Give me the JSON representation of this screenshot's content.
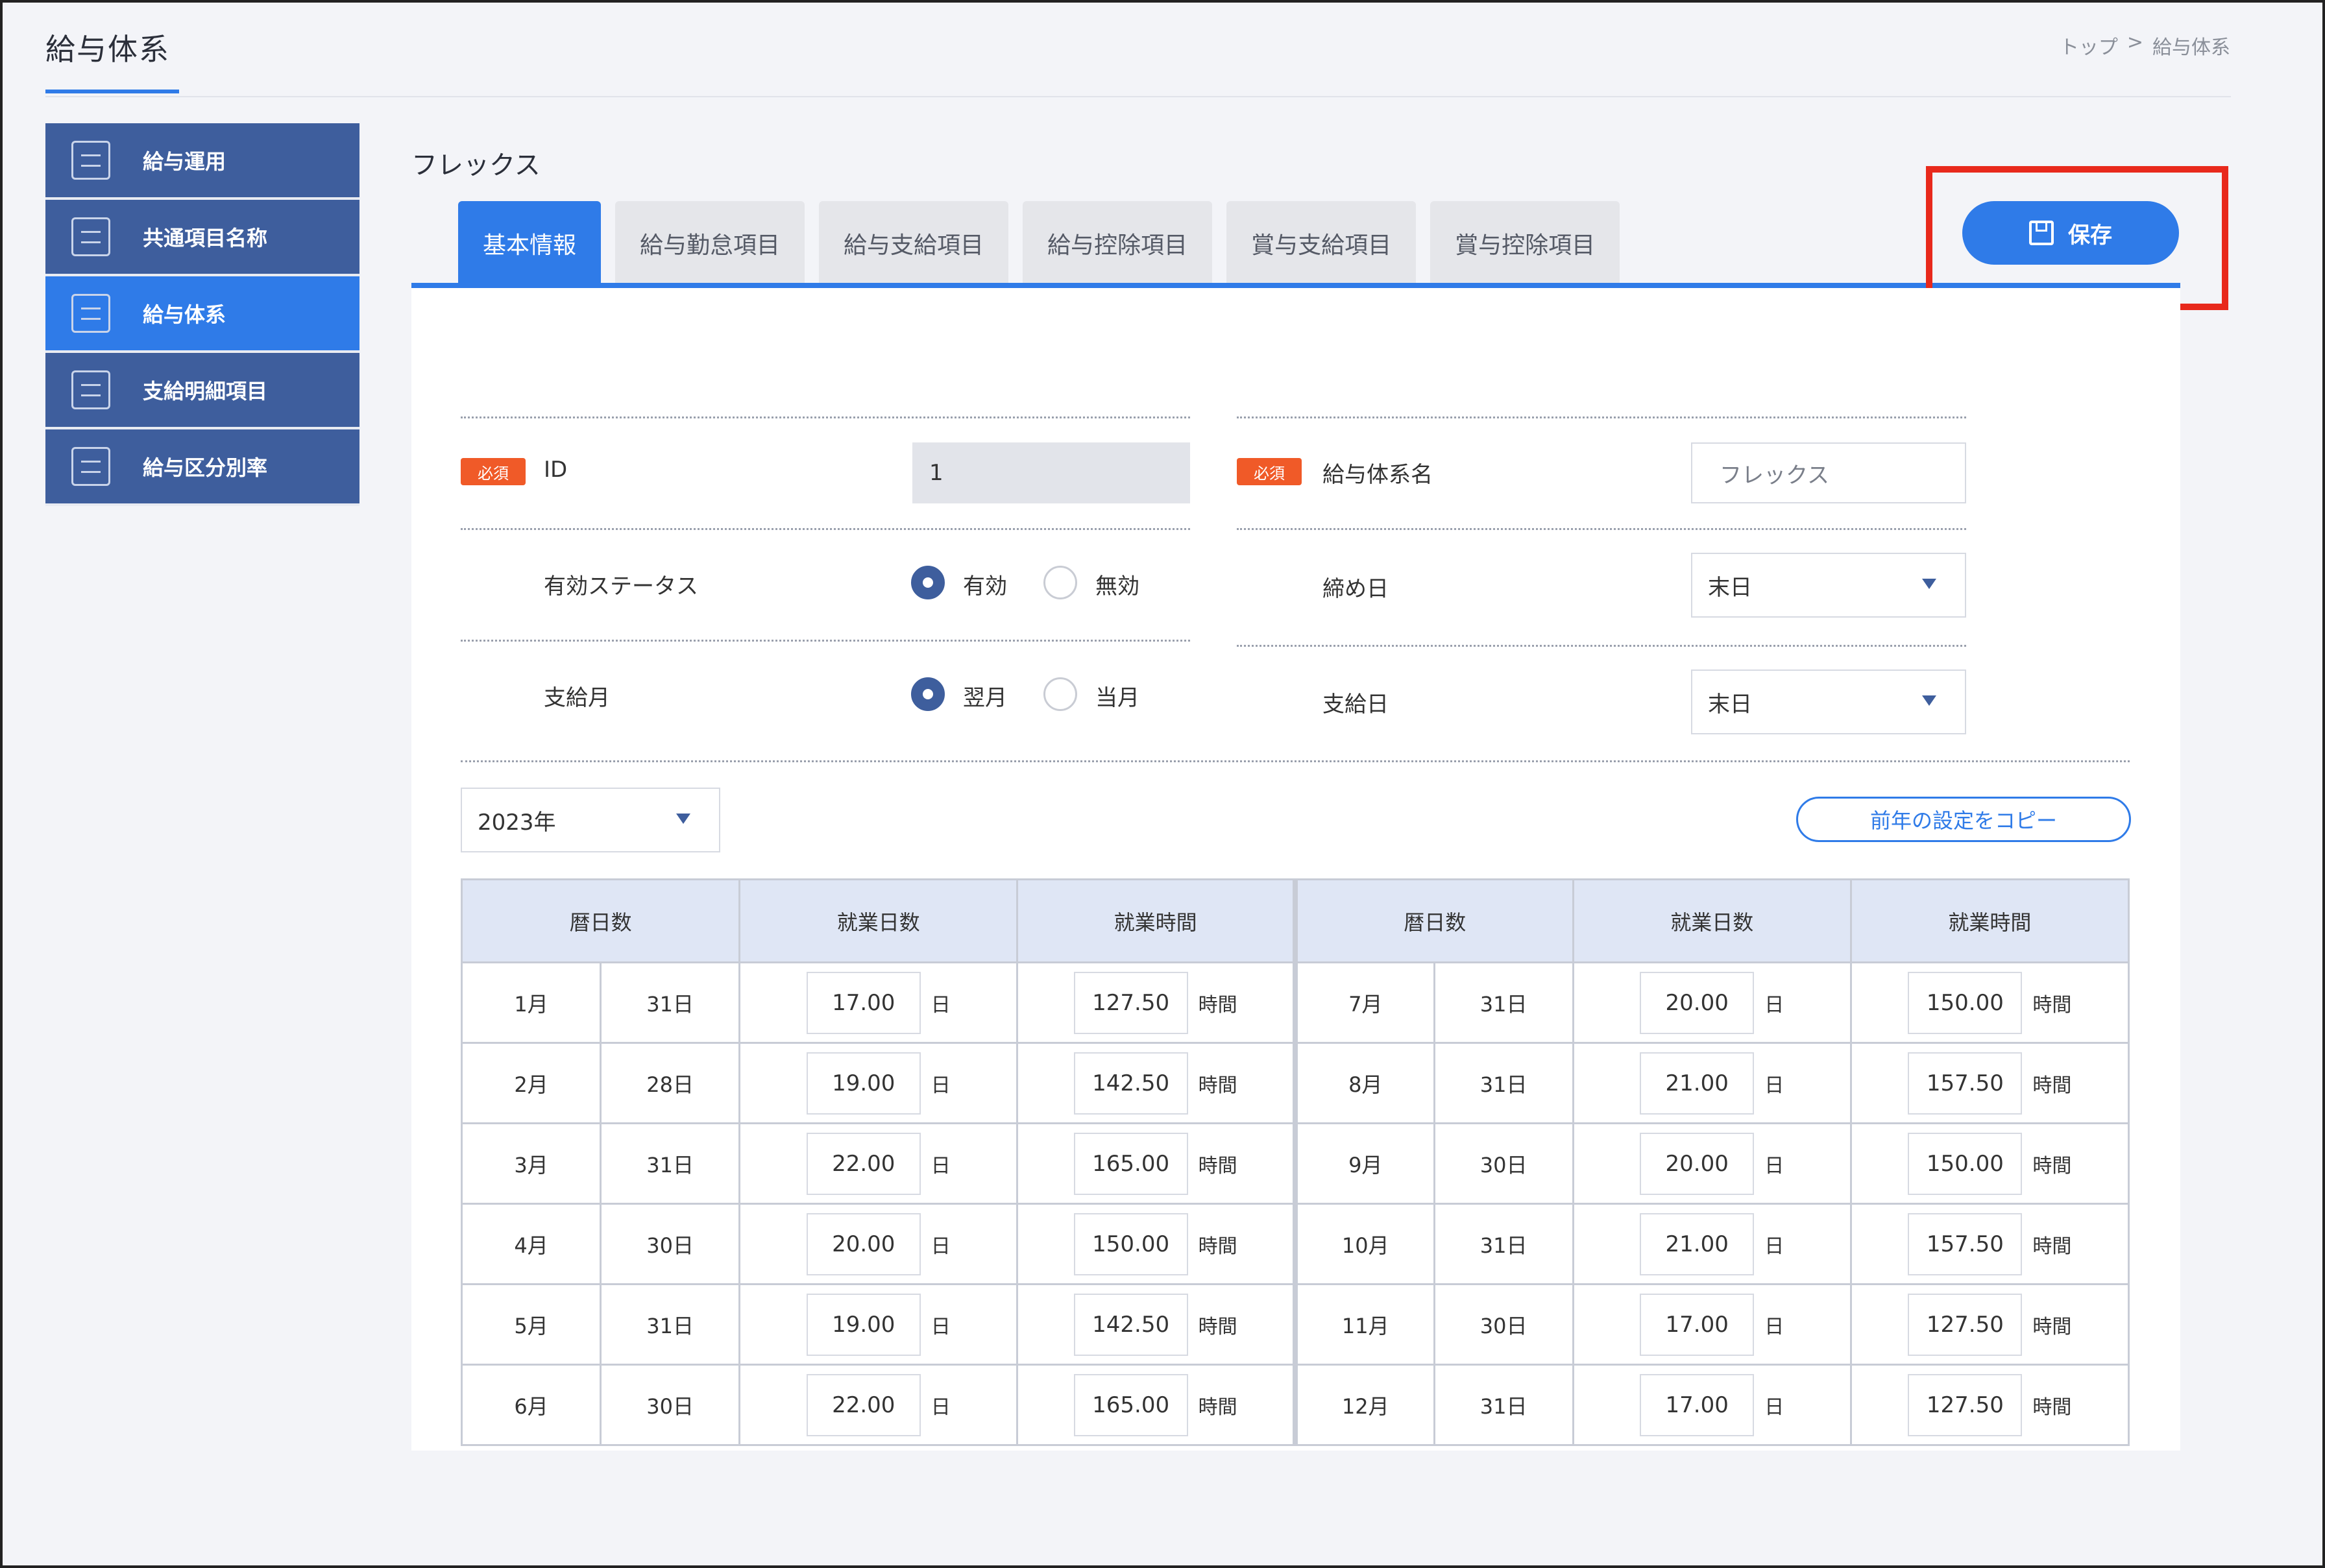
{
  "header": {
    "title": "給与体系",
    "breadcrumb": [
      "トップ",
      ">",
      "給与体系"
    ]
  },
  "sidebar": {
    "items": [
      {
        "label": "給与運用",
        "icon": "ledger-icon"
      },
      {
        "label": "共通項目名称",
        "icon": "document-dollar-icon"
      },
      {
        "label": "給与体系",
        "icon": "chart-doc-icon",
        "active": true
      },
      {
        "label": "支給明細項目",
        "icon": "receipt-icon"
      },
      {
        "label": "給与区分別率",
        "icon": "calculator-icon"
      }
    ]
  },
  "main": {
    "section_title": "フレックス",
    "tabs": [
      "基本情報",
      "給与勤怠項目",
      "給与支給項目",
      "給与控除項目",
      "賞与支給項目",
      "賞与控除項目"
    ],
    "save_label": "保存"
  },
  "form": {
    "required_badge": "必須",
    "id_label": "ID",
    "id_value": "1",
    "name_label": "給与体系名",
    "name_value": "フレックス",
    "status_label": "有効ステータス",
    "status_on": "有効",
    "status_off": "無効",
    "closing_label": "締め日",
    "closing_value": "末日",
    "paymonth_label": "支給月",
    "paymonth_next": "翌月",
    "paymonth_same": "当月",
    "payday_label": "支給日",
    "payday_value": "末日"
  },
  "year_select": "2023年",
  "copy_button": "前年の設定をコピー",
  "table": {
    "headers": [
      "暦日数",
      "就業日数",
      "就業時間",
      "暦日数",
      "就業日数",
      "就業時間"
    ],
    "day_unit": "日",
    "hour_unit": "時間",
    "left": [
      {
        "month": "1月",
        "days": "31日",
        "work_days": "17.00",
        "hours": "127.50"
      },
      {
        "month": "2月",
        "days": "28日",
        "work_days": "19.00",
        "hours": "142.50"
      },
      {
        "month": "3月",
        "days": "31日",
        "work_days": "22.00",
        "hours": "165.00"
      },
      {
        "month": "4月",
        "days": "30日",
        "work_days": "20.00",
        "hours": "150.00"
      },
      {
        "month": "5月",
        "days": "31日",
        "work_days": "19.00",
        "hours": "142.50"
      },
      {
        "month": "6月",
        "days": "30日",
        "work_days": "22.00",
        "hours": "165.00"
      }
    ],
    "right": [
      {
        "month": "7月",
        "days": "31日",
        "work_days": "20.00",
        "hours": "150.00"
      },
      {
        "month": "8月",
        "days": "31日",
        "work_days": "21.00",
        "hours": "157.50"
      },
      {
        "month": "9月",
        "days": "30日",
        "work_days": "20.00",
        "hours": "150.00"
      },
      {
        "month": "10月",
        "days": "31日",
        "work_days": "21.00",
        "hours": "157.50"
      },
      {
        "month": "11月",
        "days": "30日",
        "work_days": "17.00",
        "hours": "127.50"
      },
      {
        "month": "12月",
        "days": "31日",
        "work_days": "17.00",
        "hours": "127.50"
      }
    ]
  }
}
